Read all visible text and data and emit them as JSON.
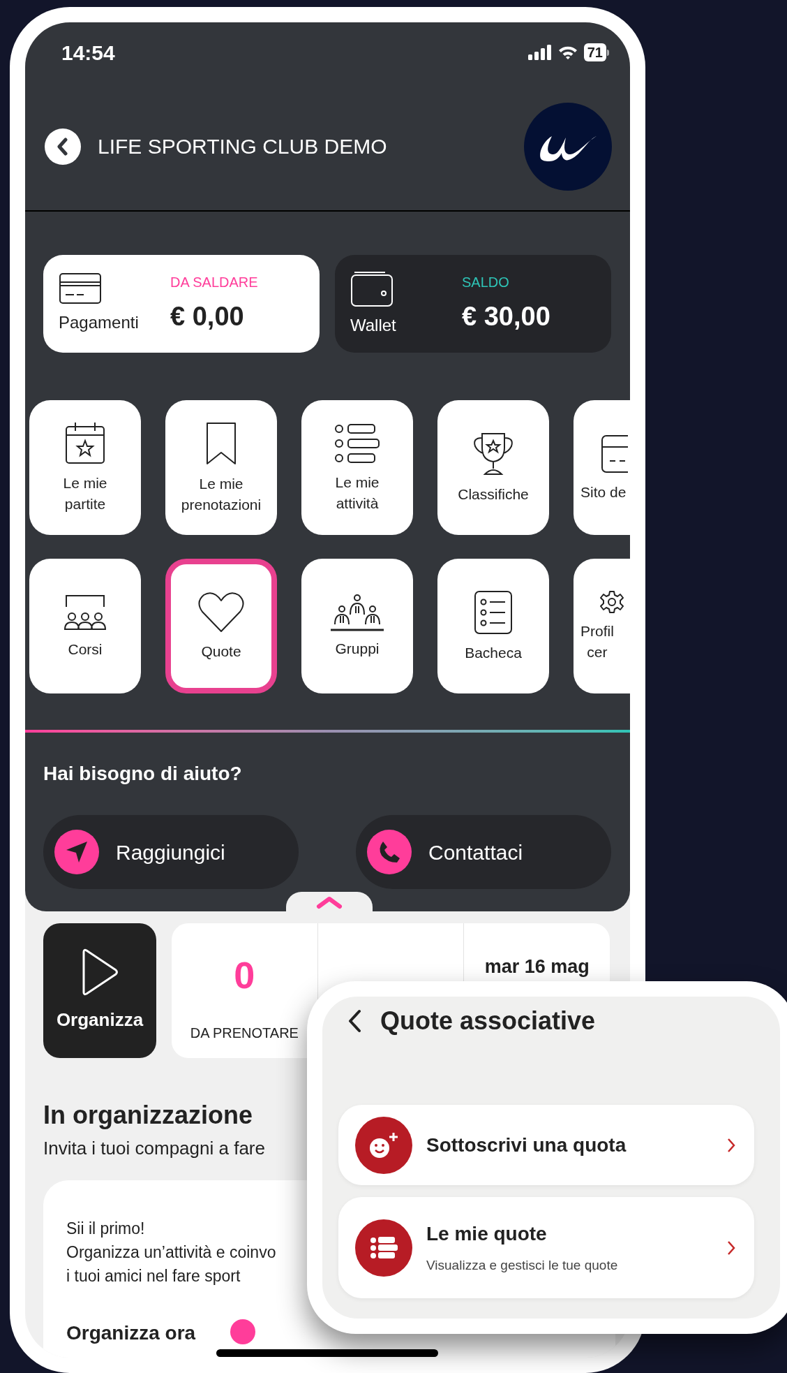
{
  "status_bar": {
    "time": "14:54",
    "battery": "71"
  },
  "header": {
    "title": "LIFE SPORTING CLUB DEMO"
  },
  "balance_cards": [
    {
      "kind": "light",
      "label": "Pagamenti",
      "caption": "DA SALDARE",
      "amount": "€ 0,00"
    },
    {
      "kind": "dark",
      "label": "Wallet",
      "caption": "SALDO",
      "amount": "€ 30,00"
    }
  ],
  "menu_tiles": [
    {
      "kind": "calendar",
      "lines": [
        "Le mie",
        "partite"
      ],
      "selected": false
    },
    {
      "kind": "bookmark",
      "lines": [
        "Le mie",
        "prenotazioni"
      ],
      "selected": false
    },
    {
      "kind": "list",
      "lines": [
        "Le mie",
        "attività"
      ],
      "selected": false
    },
    {
      "kind": "trophy",
      "lines": [
        "Classifiche"
      ],
      "selected": false
    },
    {
      "kind": "document",
      "lines": [
        "Sito de"
      ],
      "selected": false
    },
    {
      "kind": "classroom",
      "lines": [
        "Corsi"
      ],
      "selected": false
    },
    {
      "kind": "heart",
      "lines": [
        "Quote"
      ],
      "selected": true
    },
    {
      "kind": "group",
      "lines": [
        "Gruppi"
      ],
      "selected": false
    },
    {
      "kind": "board",
      "lines": [
        "Bacheca"
      ],
      "selected": false
    },
    {
      "kind": "gear",
      "lines": [
        "Profil",
        "cer"
      ],
      "selected": false
    }
  ],
  "help": {
    "title": "Hai bisogno di aiuto?",
    "buttons": [
      {
        "kind": "navigate",
        "label": "Raggiungici"
      },
      {
        "kind": "phone",
        "label": "Contattaci"
      }
    ]
  },
  "organize_tile": {
    "label": "Organizza"
  },
  "stats": [
    {
      "kind": "count",
      "value": "0",
      "caption": "DA PRENOTARE",
      "color": "#ff3d9a"
    },
    {
      "kind": "hidden"
    },
    {
      "kind": "date",
      "value": "mar 16 mag"
    }
  ],
  "organization": {
    "title": "In organizzazione",
    "subtitle": "Invita i tuoi compagni a fare",
    "card": {
      "heading": "Sii il primo!",
      "lines": [
        "Organizza un’attività e coinvo",
        "i tuoi amici nel fare sport"
      ],
      "action": "Organizza ora"
    }
  },
  "overlay": {
    "title": "Quote associative",
    "items": [
      {
        "kind": "subscribe",
        "title": "Sottoscrivi una quota"
      },
      {
        "kind": "list",
        "title": "Le mie quote",
        "subtitle": "Visualizza e gestisci le tue quote"
      }
    ]
  }
}
